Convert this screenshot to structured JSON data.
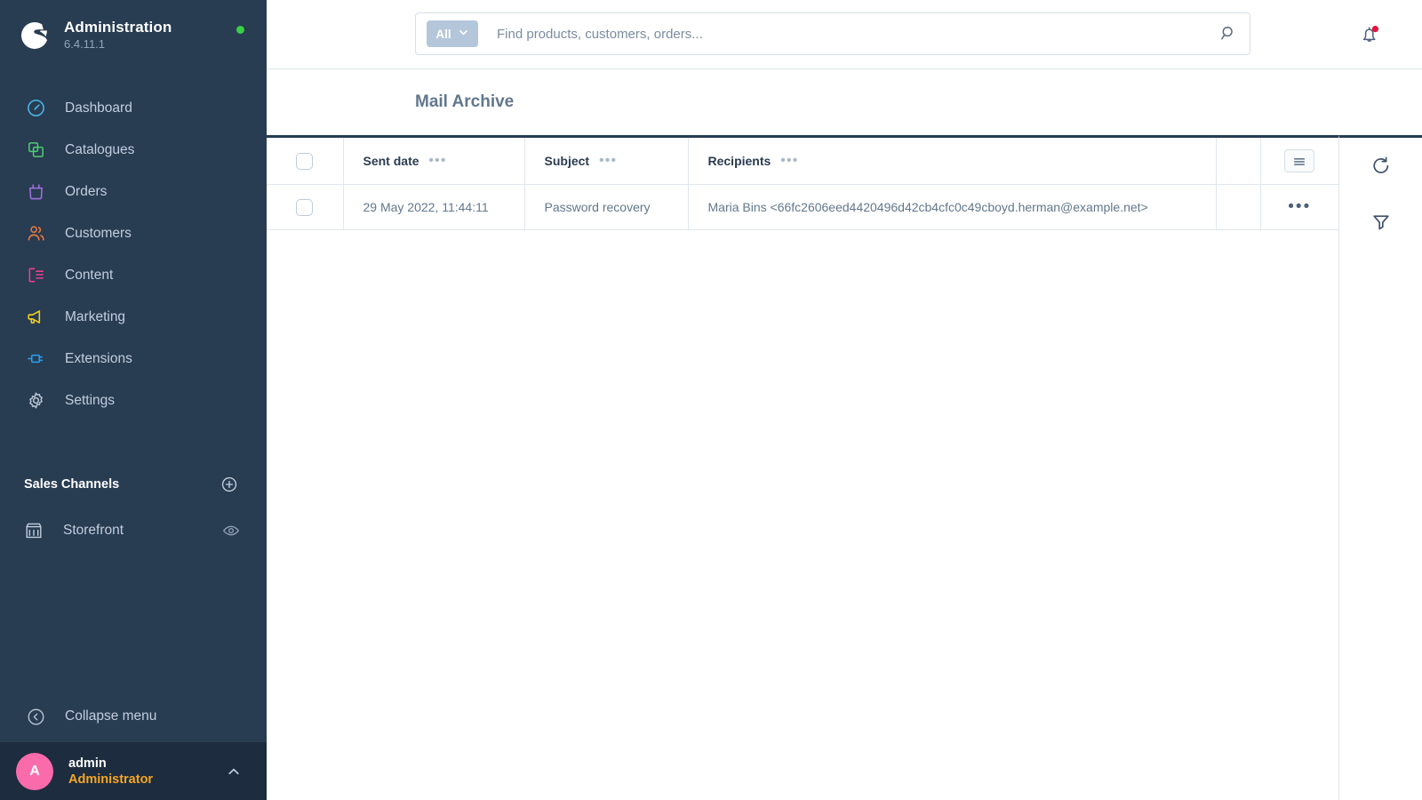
{
  "sidebar": {
    "logo_icon": "shopware-logo-icon",
    "title": "Administration",
    "version": "6.4.11.1",
    "status_dot_color": "#37d046",
    "nav": [
      {
        "label": "Dashboard",
        "icon": "dashboard-icon",
        "color": "#4db8e8"
      },
      {
        "label": "Catalogues",
        "icon": "catalogues-icon",
        "color": "#4ecb71"
      },
      {
        "label": "Orders",
        "icon": "orders-icon",
        "color": "#a070e0"
      },
      {
        "label": "Customers",
        "icon": "customers-icon",
        "color": "#f07a3c"
      },
      {
        "label": "Content",
        "icon": "content-icon",
        "color": "#ec3f8e"
      },
      {
        "label": "Marketing",
        "icon": "marketing-icon",
        "color": "#f5d019"
      },
      {
        "label": "Extensions",
        "icon": "extensions-icon",
        "color": "#2aa0f0"
      },
      {
        "label": "Settings",
        "icon": "settings-icon",
        "color": "#b6c2d1"
      }
    ],
    "sales_channels": {
      "title": "Sales Channels",
      "add_icon": "plus-circle-icon",
      "items": [
        {
          "label": "Storefront",
          "icon": "storefront-icon",
          "action_icon": "eye-icon"
        }
      ]
    },
    "collapse": {
      "label": "Collapse menu",
      "icon": "collapse-left-icon"
    },
    "user": {
      "avatar_initial": "A",
      "avatar_color": "#fa6bab",
      "name": "admin",
      "role": "Administrator",
      "role_color": "#f5a623",
      "chevron_icon": "chevron-up-icon"
    }
  },
  "topbar": {
    "search": {
      "scope_label": "All",
      "scope_chevron_icon": "chevron-down-icon",
      "placeholder": "Find products, customers, orders...",
      "value": "",
      "search_icon": "search-icon"
    },
    "notifications": {
      "icon": "bell-icon",
      "has_badge": true,
      "badge_color": "#e5133c"
    }
  },
  "page": {
    "title": "Mail Archive"
  },
  "grid": {
    "select_all_checkbox": false,
    "columns": [
      {
        "label": "Sent date",
        "menu_icon": "column-menu-icon"
      },
      {
        "label": "Subject",
        "menu_icon": "column-menu-icon"
      },
      {
        "label": "Recipients",
        "menu_icon": "column-menu-icon"
      }
    ],
    "settings_button_icon": "list-settings-icon",
    "rows": [
      {
        "selected": false,
        "sent_date": "29 May 2022, 11:44:11",
        "subject": "Password recovery",
        "recipients": "Maria Bins <66fc2606eed4420496d42cb4cfc0c49cboyd.herman@example.net>",
        "context_menu_icon": "more-dots-icon"
      }
    ]
  },
  "right_toolbar": {
    "buttons": [
      {
        "icon": "refresh-icon",
        "name": "refresh-button"
      },
      {
        "icon": "filter-funnel-icon",
        "name": "filter-button"
      }
    ]
  }
}
